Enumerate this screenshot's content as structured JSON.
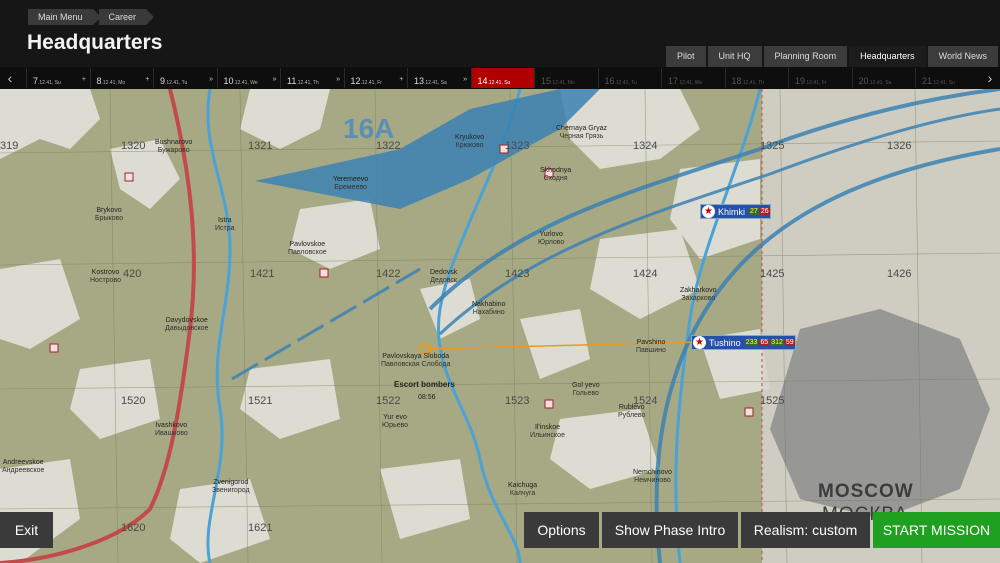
{
  "breadcrumb": {
    "items": [
      "Main Menu",
      "Career"
    ]
  },
  "page_title": "Headquarters",
  "nav_tabs": [
    {
      "label": "Pilot",
      "active": false
    },
    {
      "label": "Unit HQ",
      "active": false
    },
    {
      "label": "Planning Room",
      "active": false
    },
    {
      "label": "Headquarters",
      "active": true
    },
    {
      "label": "World News",
      "active": false
    }
  ],
  "timeline": {
    "days": [
      {
        "num": "7",
        "sub": ".12.41, Su",
        "mark": "+"
      },
      {
        "num": "8",
        "sub": ".12.41, Mo",
        "mark": "+"
      },
      {
        "num": "9",
        "sub": ".12.41, Tu",
        "mark": "»"
      },
      {
        "num": "10",
        "sub": ".12.41, We",
        "mark": "»"
      },
      {
        "num": "11",
        "sub": ".12.41, Th",
        "mark": "»"
      },
      {
        "num": "12",
        "sub": ".12.41, Fr",
        "mark": "+"
      },
      {
        "num": "13",
        "sub": ".12.41, Sa",
        "mark": "»"
      },
      {
        "num": "14",
        "sub": ".12.41, Su",
        "mark": "",
        "state": "current"
      },
      {
        "num": "15",
        "sub": ".12.41, Mo",
        "mark": "",
        "state": "future"
      },
      {
        "num": "16",
        "sub": ".12.41, Tu",
        "mark": "",
        "state": "future"
      },
      {
        "num": "17",
        "sub": ".12.41, We",
        "mark": "",
        "state": "future"
      },
      {
        "num": "18",
        "sub": ".12.41, Th",
        "mark": "",
        "state": "future"
      },
      {
        "num": "19",
        "sub": ".12.41, Fr",
        "mark": "",
        "state": "future"
      },
      {
        "num": "20",
        "sub": ".12.41, Sa",
        "mark": "",
        "state": "future"
      },
      {
        "num": "21",
        "sub": ".12.41, Su",
        "mark": "",
        "state": "future"
      }
    ]
  },
  "map": {
    "grid_squares": [
      "319",
      "1320",
      "1321",
      "1322",
      "1323",
      "1324",
      "1325",
      "1326",
      "420",
      "1421",
      "1422",
      "1423",
      "1424",
      "1425",
      "1426",
      "1520",
      "1521",
      "1522",
      "1523",
      "1524",
      "1525",
      "1620",
      "1621"
    ],
    "army_label": "16A",
    "towns": [
      {
        "en": "Kryukovo",
        "ru": "Крюково"
      },
      {
        "en": "Chernaya Gryaz",
        "ru": "Черная Грязь"
      },
      {
        "en": "Bushnarovo",
        "ru": "Бужарово"
      },
      {
        "en": "Skhodnya",
        "ru": "Сходня"
      },
      {
        "en": "Yeremeevo",
        "ru": "Еремеево"
      },
      {
        "en": "Brykovo",
        "ru": "Брыково"
      },
      {
        "en": "Istra",
        "ru": "Истра"
      },
      {
        "en": "Pavlovskoe",
        "ru": "Павловское"
      },
      {
        "en": "Yurlovo",
        "ru": "Юрлово"
      },
      {
        "en": "Kostrovo",
        "ru": "Нострово"
      },
      {
        "en": "Dedovsk",
        "ru": "Дедовск"
      },
      {
        "en": "Zakharkovo",
        "ru": "Захарково"
      },
      {
        "en": "Nakhabino",
        "ru": "Нахабино"
      },
      {
        "en": "Davydovskoe",
        "ru": "Давыдовское"
      },
      {
        "en": "Pavlovskaya Sloboda",
        "ru": "Павловская Слобода"
      },
      {
        "en": "Pavshino",
        "ru": "Павшино"
      },
      {
        "en": "Gol yevo",
        "ru": "Гольево"
      },
      {
        "en": "Yur evo",
        "ru": "Юрьево"
      },
      {
        "en": "Rublevo",
        "ru": "Рублево"
      },
      {
        "en": "Ivashkovo",
        "ru": "Ивашково"
      },
      {
        "en": "Il'inskoe",
        "ru": "Ильинское"
      },
      {
        "en": "Andreevskoe",
        "ru": "Андреевское"
      },
      {
        "en": "Nemchinovo",
        "ru": "Немчиново"
      },
      {
        "en": "Zvenigorod",
        "ru": "Звенигород"
      },
      {
        "en": "Kaichuga",
        "ru": "Калчуга"
      }
    ],
    "moscow_en": "MOSCOW",
    "moscow_ru": "МОСКВА",
    "airfields": [
      {
        "name": "Khimki",
        "stats": [
          "27",
          "26"
        ]
      },
      {
        "name": "Tushino",
        "stats": [
          "233",
          "65",
          "312",
          "59"
        ]
      }
    ],
    "escort": {
      "label": "Escort bombers",
      "time": "08:56"
    },
    "colors": {
      "forest": "#a6a983",
      "field": "#dcdcd2",
      "river": "#4aa2d6",
      "front": "#3c82b4",
      "road": "#c24a4a",
      "route": "#e89a20",
      "city": "#8d8d8d"
    }
  },
  "buttons": {
    "exit": "Exit",
    "options": "Options",
    "phase_intro": "Show Phase Intro",
    "realism": "Realism: custom",
    "start": "START MISSION"
  }
}
